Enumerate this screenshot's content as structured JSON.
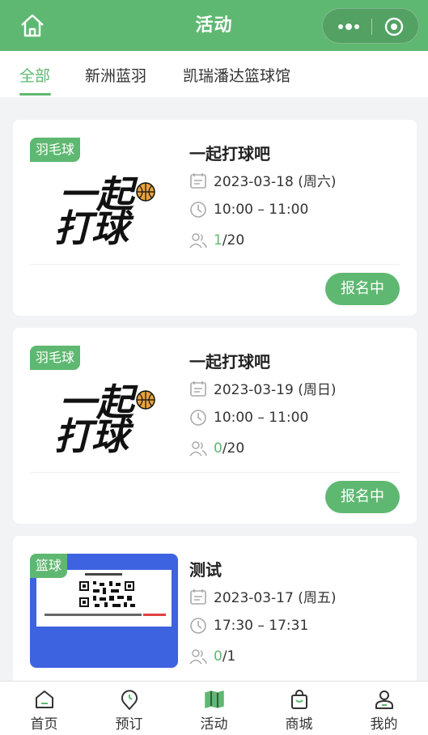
{
  "header": {
    "title": "活动"
  },
  "tabs": [
    {
      "label": "全部",
      "active": true
    },
    {
      "label": "新洲蓝羽",
      "active": false
    },
    {
      "label": "凯瑞潘达篮球馆",
      "active": false
    }
  ],
  "activities": [
    {
      "tag": "羽毛球",
      "title": "一起打球吧",
      "date": "2023-03-18 (周六)",
      "time": "10:00 – 11:00",
      "joined": "1",
      "capacity": "/20",
      "status": "报名中",
      "poster_text_1": "一起",
      "poster_text_2": "打球"
    },
    {
      "tag": "羽毛球",
      "title": "一起打球吧",
      "date": "2023-03-19 (周日)",
      "time": "10:00 – 11:00",
      "joined": "0",
      "capacity": "/20",
      "status": "报名中",
      "poster_text_1": "一起",
      "poster_text_2": "打球"
    },
    {
      "tag": "篮球",
      "title": "测试",
      "date": "2023-03-17 (周五)",
      "time": "17:30 – 17:31",
      "joined": "0",
      "capacity": "/1"
    }
  ],
  "bottom_nav": [
    {
      "label": "首页",
      "icon": "home-icon"
    },
    {
      "label": "预订",
      "icon": "clock-pin-icon"
    },
    {
      "label": "活动",
      "icon": "map-icon",
      "active": true
    },
    {
      "label": "商城",
      "icon": "shopping-bag-icon"
    },
    {
      "label": "我的",
      "icon": "user-icon"
    }
  ],
  "colors": {
    "accent": "#5fb871",
    "poster_blue": "#3e63e0"
  }
}
